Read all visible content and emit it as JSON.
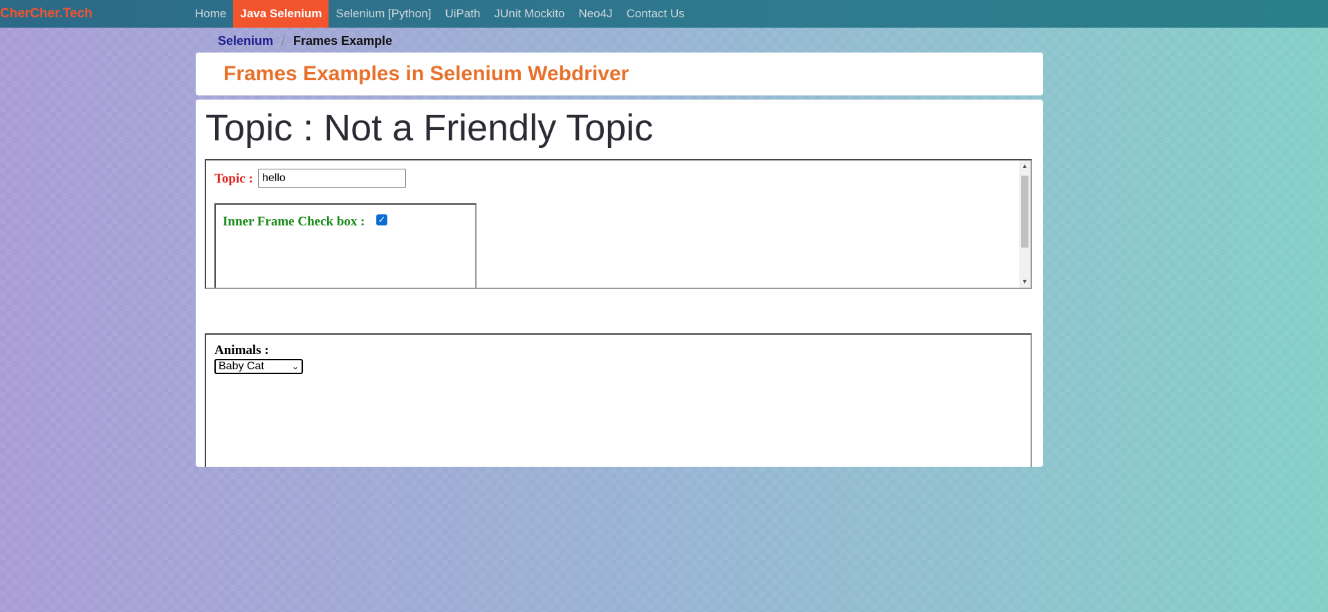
{
  "brand": "CherCher.Tech",
  "nav": {
    "items": [
      {
        "label": "Home"
      },
      {
        "label": "Java Selenium"
      },
      {
        "label": "Selenium [Python]"
      },
      {
        "label": "UiPath"
      },
      {
        "label": "JUnit Mockito"
      },
      {
        "label": "Neo4J"
      },
      {
        "label": "Contact Us"
      }
    ],
    "active": "Java Selenium"
  },
  "breadcrumb": {
    "link": "Selenium",
    "separator": "/",
    "current": "Frames Example"
  },
  "header": {
    "title": "Frames Examples in Selenium Webdriver"
  },
  "main": {
    "topic_heading": "Topic : Not a Friendly Topic",
    "frame1": {
      "topic_label": "Topic :",
      "topic_value": "hello",
      "inner_frame": {
        "label": "Inner Frame Check box :",
        "checked": true
      }
    },
    "frame2": {
      "animals_label": "Animals :",
      "selected_animal": "Baby Cat"
    }
  },
  "colors": {
    "brand": "#f2542d",
    "active_nav": "#f2542d",
    "header_title": "#e8702a",
    "topic_label": "#e0201b",
    "inner_label": "#1a8a1a"
  }
}
